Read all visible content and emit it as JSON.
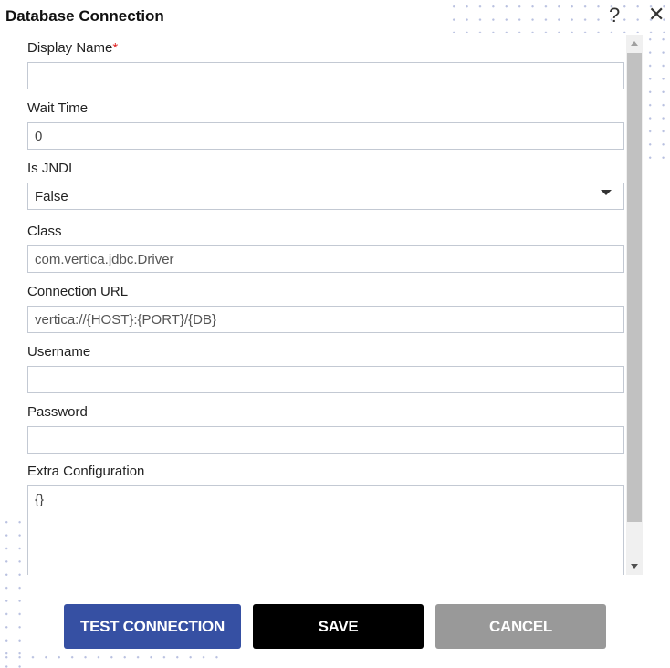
{
  "dialog": {
    "title": "Database Connection",
    "help_icon": "question-mark-icon",
    "close_icon": "close-x-icon"
  },
  "fields": [
    {
      "label": "Display Name",
      "required_mark": "*",
      "value": ""
    },
    {
      "label": "Wait Time",
      "value": "0"
    },
    {
      "label": "Is JNDI",
      "value": "False"
    },
    {
      "label": "Class",
      "value": "com.vertica.jdbc.Driver"
    },
    {
      "label": "Connection URL",
      "value": "vertica://{HOST}:{PORT}/{DB}"
    },
    {
      "label": "Username",
      "value": ""
    },
    {
      "label": "Password",
      "value": ""
    },
    {
      "label": "Extra Configuration",
      "value": "{}"
    }
  ],
  "buttons": {
    "test": "TEST CONNECTION",
    "save": "SAVE",
    "cancel": "CANCEL"
  },
  "colors": {
    "test": "#3650a3",
    "save": "#000000",
    "cancel": "#999999"
  }
}
